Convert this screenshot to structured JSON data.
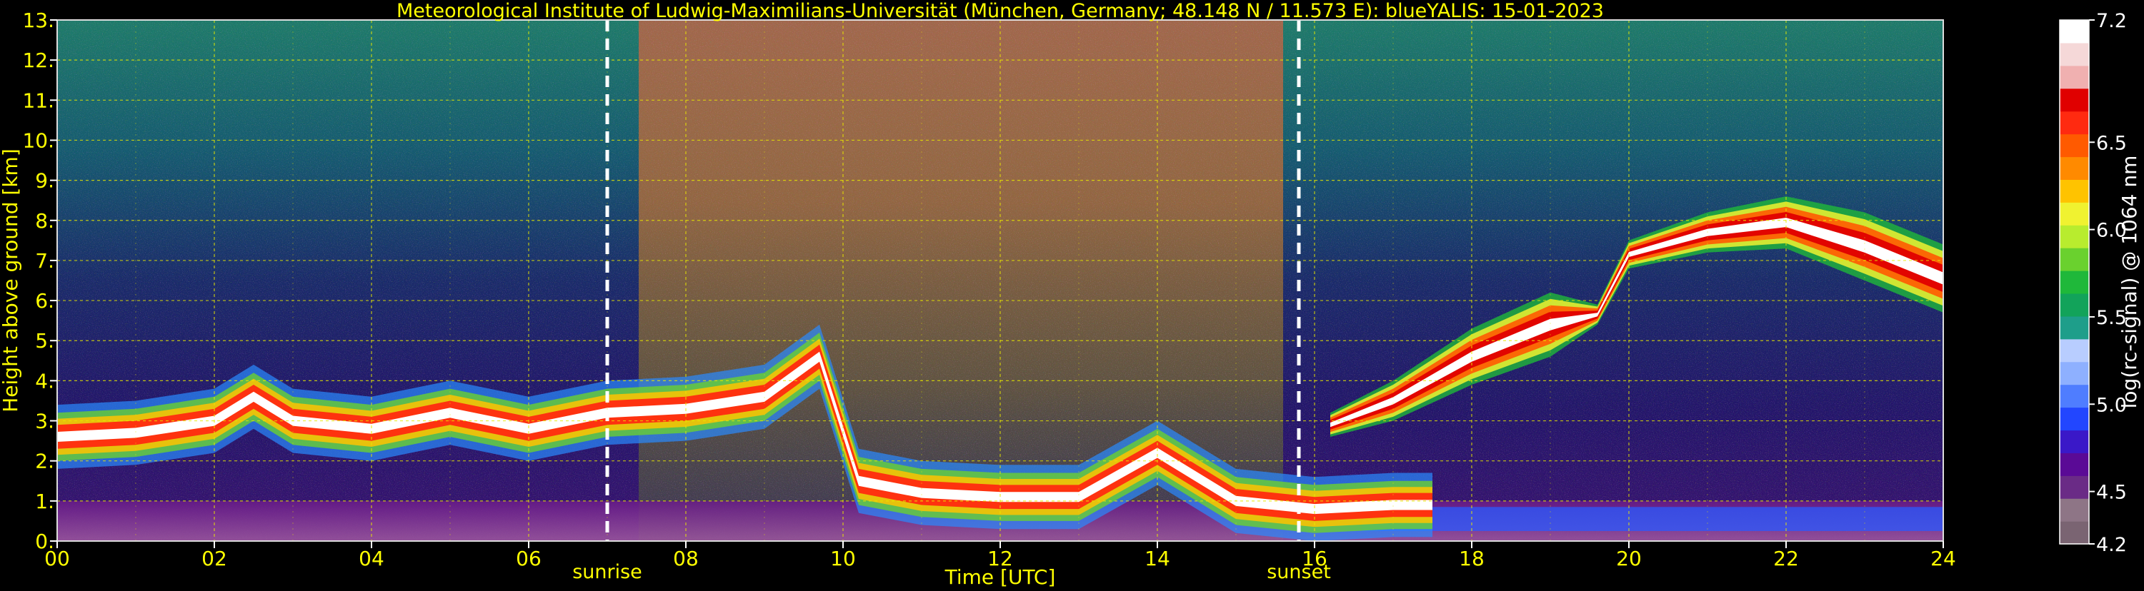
{
  "chart_data": {
    "type": "heatmap",
    "title": "Meteorological Institute of Ludwig-Maximilians-Universität (München, Germany; 48.148 N / 11.573 E):    blueYALIS: 15-01-2023",
    "xlabel": "Time [UTC]",
    "ylabel": "Height above ground [km]",
    "colorbar_label": "log(rc-signal) @ 1064 nm",
    "xlim": [
      0,
      24
    ],
    "ylim": [
      0,
      13
    ],
    "clim": [
      4.2,
      7.2
    ],
    "grid": true,
    "x_ticks": [
      0,
      2,
      4,
      6,
      8,
      10,
      12,
      14,
      16,
      18,
      20,
      22,
      24
    ],
    "x_tick_labels": [
      "00",
      "02",
      "04",
      "06",
      "08",
      "10",
      "12",
      "14",
      "16",
      "18",
      "20",
      "22",
      "24"
    ],
    "y_ticks": [
      0,
      1,
      2,
      3,
      4,
      5,
      6,
      7,
      8,
      9,
      10,
      11,
      12,
      13
    ],
    "y_tick_labels": [
      "0.",
      "1.",
      "2.",
      "3.",
      "4.",
      "5.",
      "6.",
      "7.",
      "8.",
      "9.",
      "10.",
      "11.",
      "12.",
      "13."
    ],
    "colorbar_ticks": [
      4.2,
      4.5,
      5.0,
      5.5,
      6.0,
      6.5,
      7.2
    ],
    "colorbar_tick_labels": [
      "4.2",
      "4.5",
      "5.0",
      "5.5",
      "6.0",
      "6.5",
      "7.2"
    ],
    "annotations": [
      {
        "label": "sunrise",
        "x": 7.0
      },
      {
        "label": "sunset",
        "x": 15.8
      }
    ],
    "layers": {
      "boundary_layer_top": [
        [
          0,
          2.6
        ],
        [
          1,
          2.7
        ],
        [
          2,
          3.0
        ],
        [
          2.5,
          3.6
        ],
        [
          3,
          3.0
        ],
        [
          4,
          2.8
        ],
        [
          5,
          3.2
        ],
        [
          6,
          2.8
        ],
        [
          7,
          3.2
        ],
        [
          8,
          3.3
        ],
        [
          9,
          3.6
        ],
        [
          9.7,
          4.6
        ],
        [
          10.2,
          1.5
        ],
        [
          11,
          1.2
        ],
        [
          12,
          1.1
        ],
        [
          13,
          1.1
        ],
        [
          14,
          2.2
        ],
        [
          15,
          1.0
        ],
        [
          16,
          0.8
        ],
        [
          17,
          0.9
        ],
        [
          17.5,
          0.9
        ]
      ],
      "lofted_layer_base": [
        [
          16.2,
          2.6
        ],
        [
          17,
          3.0
        ],
        [
          18,
          3.9
        ],
        [
          19,
          4.6
        ],
        [
          19.6,
          5.4
        ],
        [
          20,
          6.8
        ],
        [
          21,
          7.2
        ],
        [
          22,
          7.3
        ],
        [
          23,
          6.5
        ],
        [
          24,
          5.7
        ]
      ],
      "lofted_layer_top": [
        [
          16.2,
          3.2
        ],
        [
          17,
          4.0
        ],
        [
          18,
          5.3
        ],
        [
          19,
          6.2
        ],
        [
          19.6,
          5.9
        ],
        [
          20,
          7.5
        ],
        [
          21,
          8.2
        ],
        [
          22,
          8.6
        ],
        [
          23,
          8.2
        ],
        [
          24,
          7.4
        ]
      ]
    },
    "colormap": [
      "#7a6472",
      "#8e7586",
      "#6a2b86",
      "#5a0a96",
      "#3a18c8",
      "#2246ff",
      "#4f7dff",
      "#8eb0ff",
      "#b8cdff",
      "#1e9e8a",
      "#12a35a",
      "#1fb83a",
      "#6ad12e",
      "#b8ec2e",
      "#f0f230",
      "#ffc300",
      "#ff8a00",
      "#ff5a00",
      "#ff2a10",
      "#e00000",
      "#f0b0b0",
      "#f5d8d8",
      "#ffffff"
    ],
    "grid_color": "#e8e800",
    "text_color": "#ffff00"
  }
}
